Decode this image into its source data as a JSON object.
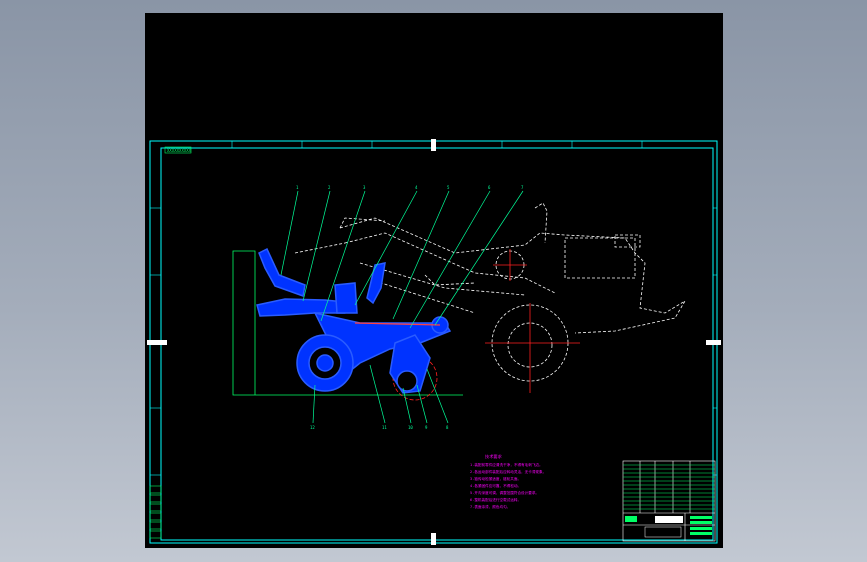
{
  "drawing": {
    "title_tag": "XXXXXXXXXX",
    "part_callouts_top": [
      "1",
      "2",
      "3",
      "4",
      "5",
      "6",
      "7"
    ],
    "part_callouts_bottom": [
      "12",
      "11",
      "10",
      "9",
      "8"
    ],
    "grid_labels_top": [
      "1",
      "2",
      "3",
      "4",
      "5",
      "6",
      "7",
      "8"
    ],
    "grid_labels_side": [
      "A",
      "B",
      "C",
      "D",
      "E",
      "F"
    ],
    "notes_heading": "技术要求",
    "notes_lines": [
      "1.装配前零件应清洗干净，不得有毛刺飞边。",
      "2.各运动部件装配后应转动灵活，无卡滞现象。",
      "3.链传动松紧适度，链轮共面。",
      "4.各紧固件应可靠，不得松动。",
      "5.开沟深度可调，调整范围符合设计要求。",
      "6.整机装配后进行空载试运转。",
      "7.表面涂漆，颜色均匀。"
    ],
    "title_block_rows": 12
  },
  "colors": {
    "viewport_bg": "#000000",
    "border": "#00ffff",
    "frame_green": "#00ff66",
    "implement_fill": "#0033ff",
    "implement_stroke": "#2255ff",
    "tractor": "#ffffff",
    "center_line": "#ff2020",
    "notes": "#ff00ff",
    "leader": "#00ff99"
  }
}
